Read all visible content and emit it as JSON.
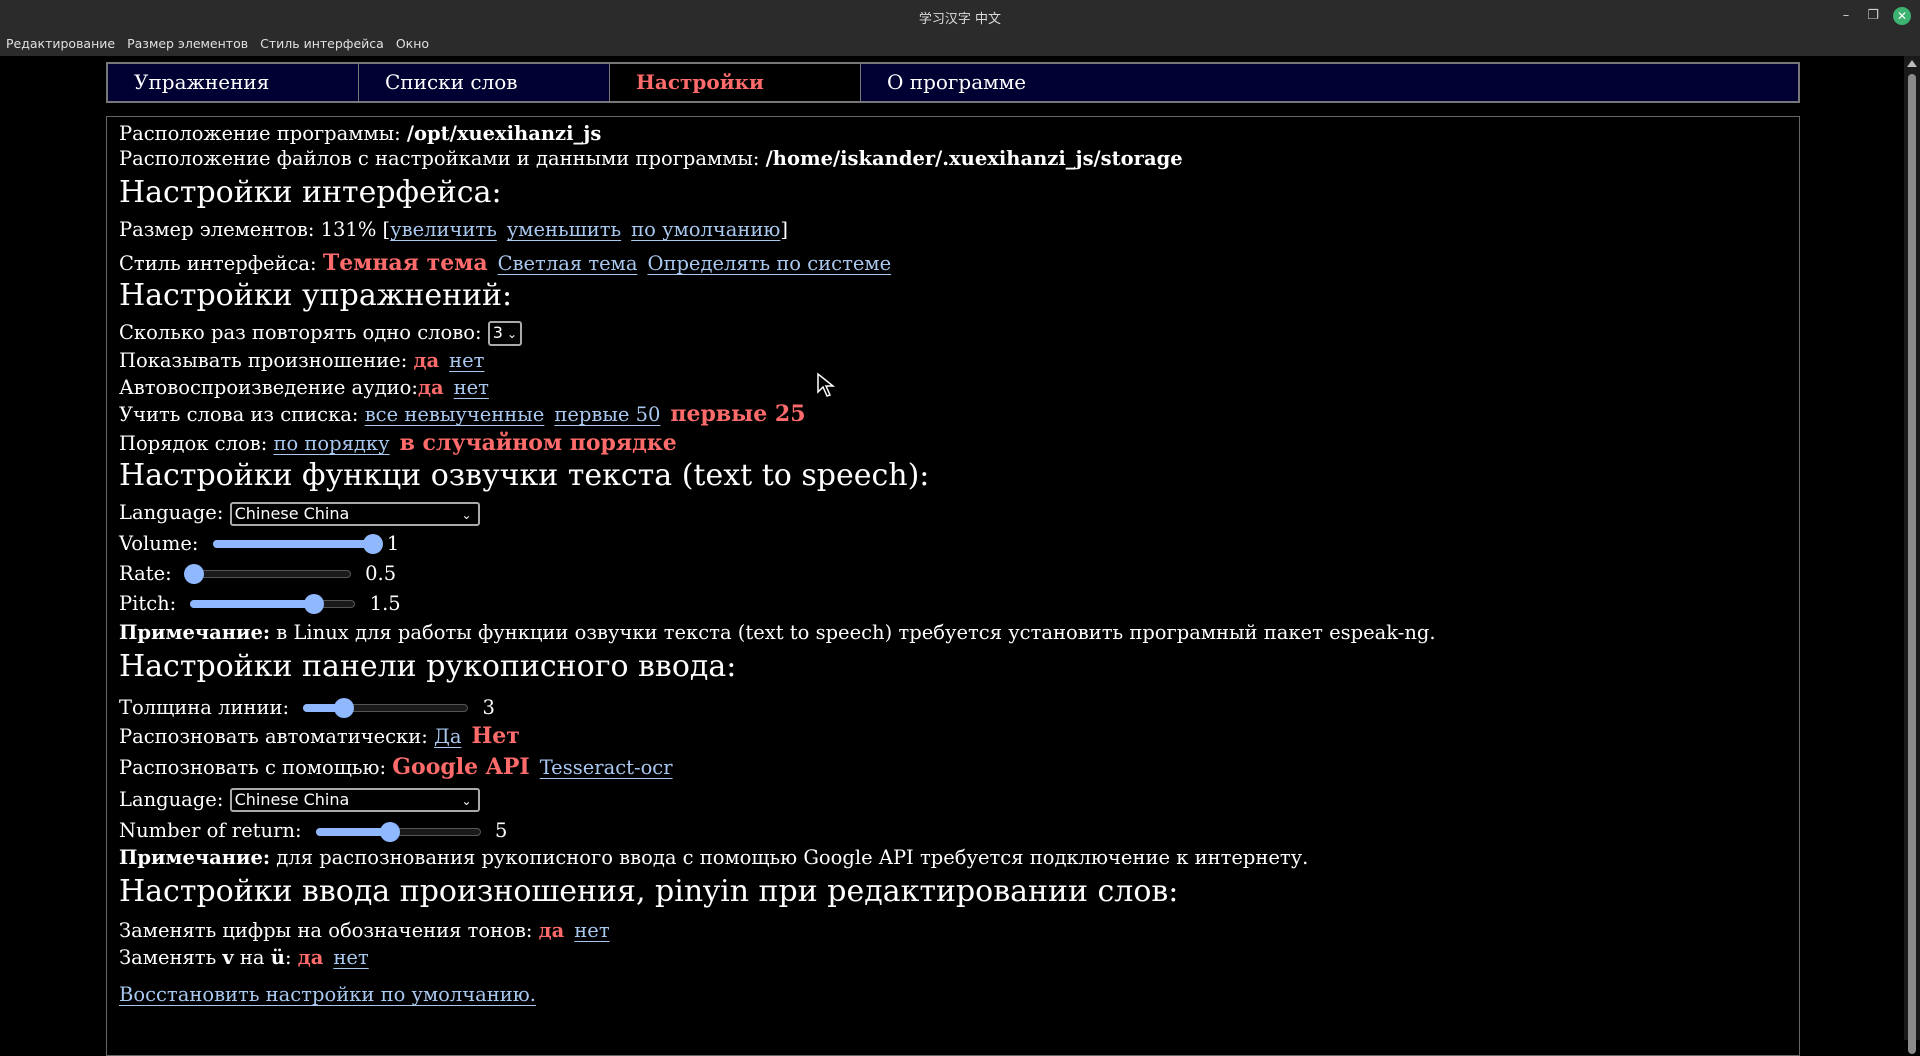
{
  "window": {
    "title": "学习汉字 中文"
  },
  "menu": [
    "Редактирование",
    "Размер элементов",
    "Стиль интерфейса",
    "Окно"
  ],
  "tabs": [
    "Упражнения",
    "Списки слов",
    "Настройки",
    "О программе"
  ],
  "active_tab": "Настройки",
  "paths": {
    "program_label": "Расположение программы:",
    "program_value": "/opt/xuexihanzi_js",
    "data_label": "Расположение файлов с настройками и данными программы:",
    "data_value": "/home/iskander/.xuexihanzi_js/storage"
  },
  "interface": {
    "heading": "Настройки интерфейса:",
    "size_label": "Размер элементов: 131% [",
    "size_increase": "увеличить",
    "size_decrease": "уменьшить",
    "size_default": "по умолчанию",
    "size_close": "]",
    "style_label": "Стиль интерфейса:",
    "style_dark": "Темная тема",
    "style_light": "Светлая тема",
    "style_system": "Определять по системе"
  },
  "exercises": {
    "heading": "Настройки упражнений:",
    "repeat_label": "Сколько раз повторять одно слово:",
    "repeat_value": "3",
    "pron_label": "Показывать произношение:",
    "pron_yes": "да",
    "pron_no": "нет",
    "audio_label": "Автовоспроизведение аудио:",
    "audio_yes": "да",
    "audio_no": "нет",
    "list_label": "Учить слова из списка:",
    "list_all": "все невыученные",
    "list_50": "первые 50",
    "list_25": "первые 25",
    "order_label": "Порядок слов:",
    "order_seq": "по порядку",
    "order_random": "в случайном порядке"
  },
  "tts": {
    "heading": "Настройки функци озвучки текста (text to speech):",
    "language_label": "Language:",
    "language_value": "Chinese China",
    "volume_label": "Volume:",
    "volume_value": "1",
    "volume_level": 1.0,
    "rate_label": "Rate:",
    "rate_value": "0.5",
    "rate_level": 0.05,
    "pitch_label": "Pitch:",
    "pitch_value": "1.5",
    "pitch_level": 0.75,
    "note_label": "Примечание:",
    "note_text": " в Linux для работы функции озвучки текста (text to speech) требуется установить програмный пакет espeak-ng."
  },
  "handwriting": {
    "heading": "Настройки панели рукописного ввода:",
    "thickness_label": "Толщина линии:",
    "thickness_value": "3",
    "thickness_level": 0.25,
    "auto_label": "Распозновать автоматически:",
    "auto_yes": "Да",
    "auto_no": "Нет",
    "engine_label": "Распозновать с помощью:",
    "engine_google": "Google API",
    "engine_tesseract": "Tesseract-ocr",
    "language_label": "Language:",
    "language_value": "Chinese China",
    "return_label": "Number of return:",
    "return_value": "5",
    "return_level": 0.45,
    "note_label": "Примечание:",
    "note_text": " для распознования рукописного ввода с помощью Google API требуется подключение к интернету."
  },
  "pinyin": {
    "heading": "Настройки ввода произношения, pinyin при редактировании слов:",
    "tones_label": "Заменять цифры на обозначения тонов:",
    "tones_yes": "да",
    "tones_no": "нет",
    "v_label_1": "Заменять ",
    "v_label_v": "v",
    "v_label_2": " на ",
    "v_label_u": "ü",
    "v_label_3": ":",
    "v_yes": "да",
    "v_no": "нет"
  },
  "restore_link": "Восстановить настройки по умолчанию."
}
